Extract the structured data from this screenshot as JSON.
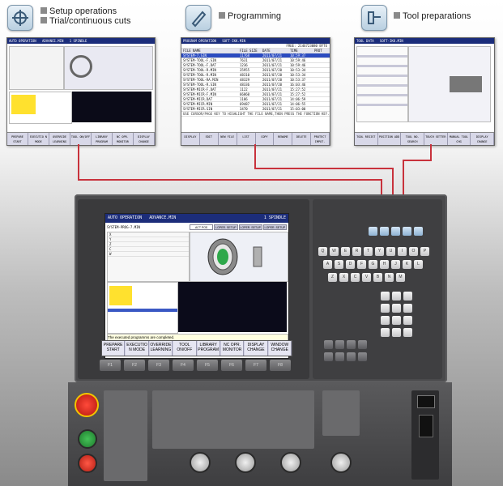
{
  "features": {
    "setup": {
      "line1": "Setup operations",
      "line2": "Trial/continuous cuts"
    },
    "programming": {
      "label": "Programming"
    },
    "tools": {
      "label": "Tool preparations"
    }
  },
  "screens": {
    "auto_op": {
      "title": "AUTO OPERATION",
      "mode": "ADVANCE.MIN",
      "spindle": "1 SPINDLE",
      "fkeys": [
        "PREPARE START",
        "EXECUTIO N MODE",
        "OVERRIDE LEARNING",
        "TOOL ON/OFF",
        "LIBRARY PROGRAM",
        "NC OPR. MONITOR",
        "DISPLAY CHANGE"
      ]
    },
    "programming": {
      "title": "PROGRAM OPERATION",
      "mode": "SOFT-IKK.MIN",
      "free": "FREE: 2146723080 BYTE",
      "headers": [
        "FILE NAME",
        "FILE SIZE",
        "DATE",
        "TIME",
        "PROT"
      ],
      "rows": [
        [
          "SYSTEM-7.SIN",
          "11768",
          "2011/07/21",
          "10:59:37",
          ""
        ],
        [
          "SYSTEM-TOOL-F.SIN",
          "7631",
          "2011/07/21",
          "10:59:46",
          ""
        ],
        [
          "SYSTEM-TOOL-F.DAT",
          "1236",
          "2011/07/21",
          "10:59:46",
          ""
        ],
        [
          "SYSTEM-TOOL-R.MIN",
          "35955",
          "2011/07/20",
          "10:53:34",
          ""
        ],
        [
          "SYSTEM-TOOL-R.MIN",
          "48310",
          "2011/07/20",
          "10:53:34",
          ""
        ],
        [
          "SYSTEM-TOOL-RA.MIN",
          "48329",
          "2011/07/20",
          "10:53:37",
          ""
        ],
        [
          "SYSTEM-TOOL-R.SIN",
          "48336",
          "2011/07/20",
          "16:03:46",
          ""
        ],
        [
          "SYSTEM-MICR-F.DAT",
          "1122",
          "2011/07/21",
          "15:27:52",
          ""
        ],
        [
          "SYSTEM-MICR-F.MIN",
          "66860",
          "2011/07/21",
          "15:27:52",
          ""
        ],
        [
          "SYSTEM-MICR.DAT",
          "1186",
          "2011/07/21",
          "14:06:59",
          ""
        ],
        [
          "SYSTEM-MICR.MIN",
          "69487",
          "2011/07/21",
          "14:06:55",
          ""
        ],
        [
          "SYSTEM-MICR.SIN",
          "3470",
          "2011/07/21",
          "15:03:00",
          ""
        ]
      ],
      "hint": "USE CURSOR/PAGE KEY TO HIGHLIGHT THE FILE NAME,THEN PRESS THE FUNCTION KEY.",
      "fkeys": [
        "DISPLAY",
        "EDIT",
        "NEW FILE",
        "LIST",
        "COPY",
        "RENAME",
        "DELETE",
        "PROTECT IMPOT."
      ]
    },
    "tool_data": {
      "title": "TOOL DATA",
      "mode": "SOFT-IKK.MIN",
      "fkeys": [
        "TOOL REGIST",
        "POSITION ADD",
        "TOOL NO. SEARCH",
        "TOUCH SETTER",
        "MANUAL TOOL CHG",
        "DISPLAY CHANGE"
      ]
    },
    "main": {
      "title": "AUTO OPERATION",
      "mode": "ADVANCE.MIN",
      "spindle": "1 SPINDLE",
      "time": "2011/07/20",
      "prog": "SYSTEM-PROG-7.MIN",
      "tabs": [
        "ACT POS",
        "I-OPER. SETUP",
        "I-OPER. SETUP",
        "I-OPER. SETUP"
      ],
      "axes": [
        "X",
        "Y",
        "Z",
        "C",
        "W"
      ],
      "message": "The executed programms are completed.",
      "fkeys": [
        "PREPARE START",
        "EXECUTIO N MODE",
        "OVERRIDE LEARNING",
        "TOOL ON/OFF",
        "LIBRARY PROGRAM",
        "NC OPR. MONITOR",
        "DISPLAY CHANGE",
        "WINDOW CHANGE"
      ]
    }
  },
  "function_keys": [
    "F1",
    "F2",
    "F3",
    "F4",
    "F5",
    "F6",
    "F7",
    "F8"
  ],
  "keyboard": {
    "row1": [
      "Q",
      "W",
      "E",
      "R",
      "T",
      "Y",
      "U",
      "I",
      "O",
      "P"
    ],
    "row2": [
      "A",
      "S",
      "D",
      "F",
      "G",
      "H",
      "J",
      "K",
      "L"
    ],
    "row3": [
      "Z",
      "X",
      "C",
      "V",
      "B",
      "N",
      "M"
    ]
  },
  "colors": {
    "wire": "#c8323c",
    "title_bar": "#1c2d7a",
    "estop": "#d0281c"
  }
}
